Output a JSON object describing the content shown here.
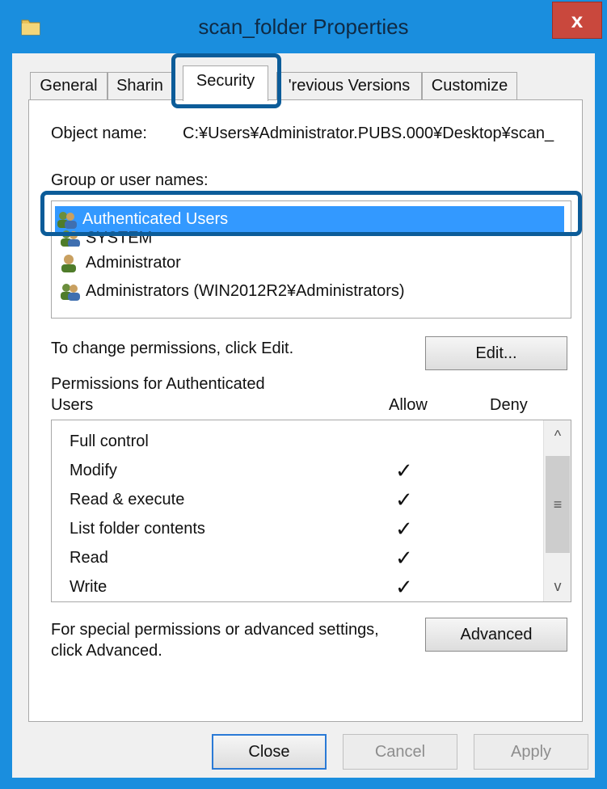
{
  "window": {
    "title": "scan_folder Properties",
    "close_glyph": "x"
  },
  "tabs": [
    {
      "label": "General",
      "active": false
    },
    {
      "label": "Sharin",
      "active": false
    },
    {
      "label": "Security",
      "active": true
    },
    {
      "label": "'revious Versions",
      "active": false
    },
    {
      "label": "Customize",
      "active": false
    }
  ],
  "security": {
    "object_name_label": "Object name:",
    "object_name_value": "C:¥Users¥Administrator.PUBS.000¥Desktop¥scan_",
    "group_label": "Group or user names:",
    "users": [
      {
        "name": "Authenticated Users",
        "icon": "users-group-icon",
        "selected": true
      },
      {
        "name": "SYSTEM",
        "icon": "users-group-icon",
        "selected": false
      },
      {
        "name": "Administrator",
        "icon": "user-icon",
        "selected": false
      },
      {
        "name": "Administrators (WIN2012R2¥Administrators)",
        "icon": "users-group-icon",
        "selected": false
      }
    ],
    "change_hint": "To change permissions, click Edit.",
    "edit_button": "Edit...",
    "permissions_label_line1": "Permissions for Authenticated",
    "permissions_label_line2": "Users",
    "allow_header": "Allow",
    "deny_header": "Deny",
    "permissions": [
      {
        "name": "Full control",
        "allow": false,
        "deny": false
      },
      {
        "name": "Modify",
        "allow": true,
        "deny": false
      },
      {
        "name": "Read & execute",
        "allow": true,
        "deny": false
      },
      {
        "name": "List folder contents",
        "allow": true,
        "deny": false
      },
      {
        "name": "Read",
        "allow": true,
        "deny": false
      },
      {
        "name": "Write",
        "allow": true,
        "deny": false
      }
    ],
    "check_glyph": "✓",
    "scroll_up_glyph": "^",
    "scroll_down_glyph": "v",
    "scroll_grip_glyph": "≡",
    "advanced_hint_line1": "For special permissions or advanced settings,",
    "advanced_hint_line2": "click Advanced.",
    "advanced_button": "Advanced"
  },
  "footer": {
    "close_button": "Close",
    "cancel_button": "Cancel",
    "apply_button": "Apply"
  },
  "colors": {
    "frame": "#1a8ede",
    "selection": "#3399ff",
    "callout": "#0c5c99",
    "close_button": "#c9483d"
  }
}
